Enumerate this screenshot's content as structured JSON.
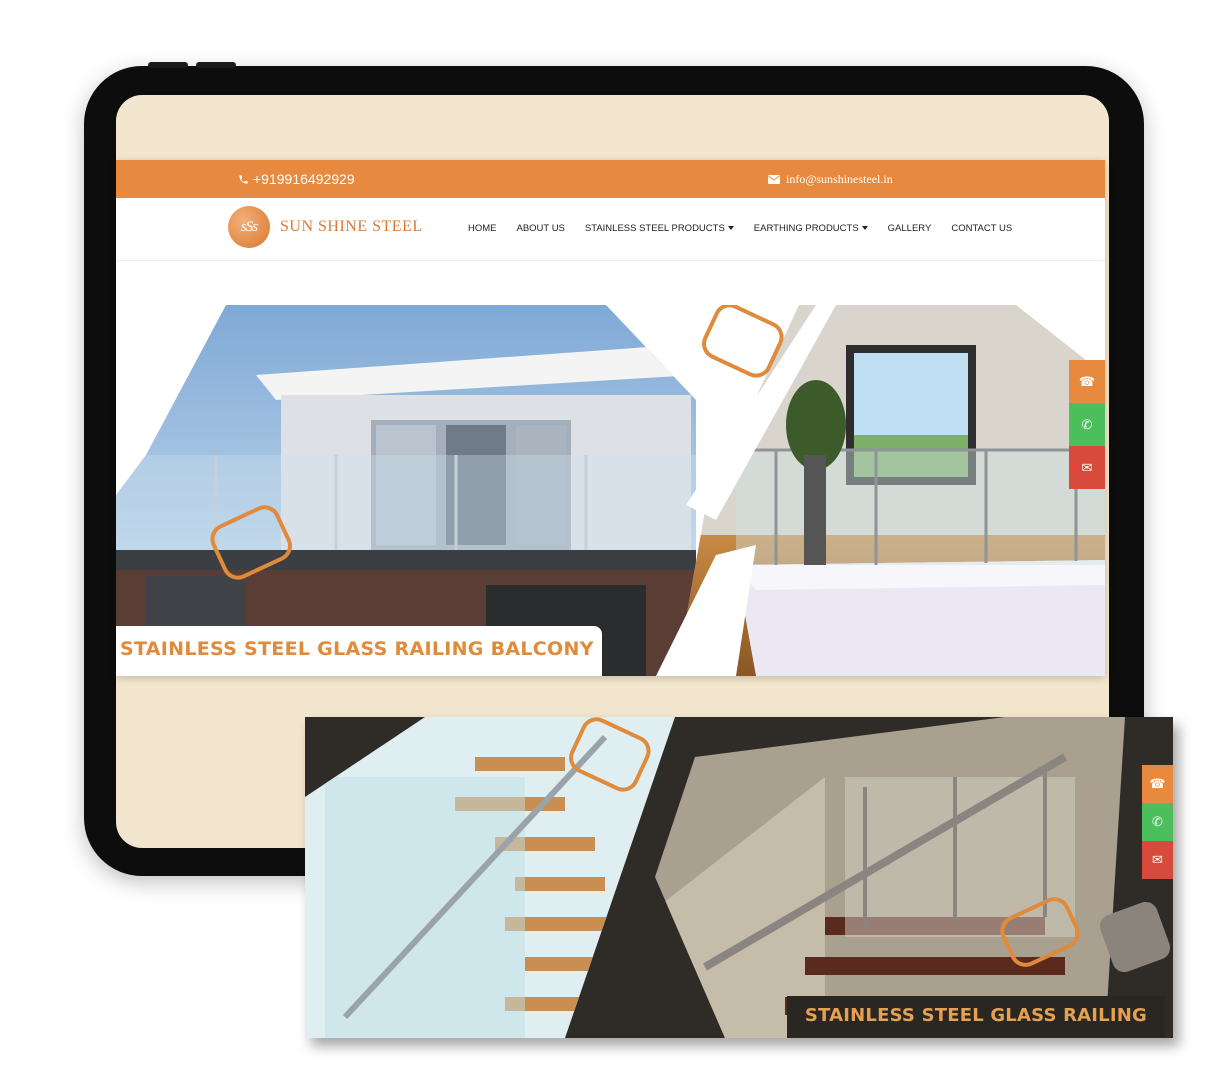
{
  "topbar": {
    "phone": "+919916492929",
    "email": "info@sunshinesteel.in"
  },
  "logo": {
    "mark": "sSs",
    "name": "SUN SHINE STEEL"
  },
  "nav": {
    "items": [
      {
        "label": "HOME",
        "dropdown": false
      },
      {
        "label": "ABOUT US",
        "dropdown": false
      },
      {
        "label": "STAINLESS STEEL PRODUCTS",
        "dropdown": true
      },
      {
        "label": "EARTHING PRODUCTS",
        "dropdown": true
      },
      {
        "label": "GALLERY",
        "dropdown": false
      },
      {
        "label": "CONTACT US",
        "dropdown": false
      }
    ]
  },
  "hero": {
    "caption": "STAINLESS STEEL GLASS RAILING BALCONY"
  },
  "banner2": {
    "caption": "STAINLESS STEEL GLASS RAILING"
  },
  "floating_buttons": [
    "phone-icon",
    "whatsapp-icon",
    "envelope-icon"
  ],
  "colors": {
    "accent": "#e78a3f",
    "whatsapp": "#4cbf5c",
    "mail": "#d84a3c",
    "screen_bg": "#f3e6ce"
  }
}
